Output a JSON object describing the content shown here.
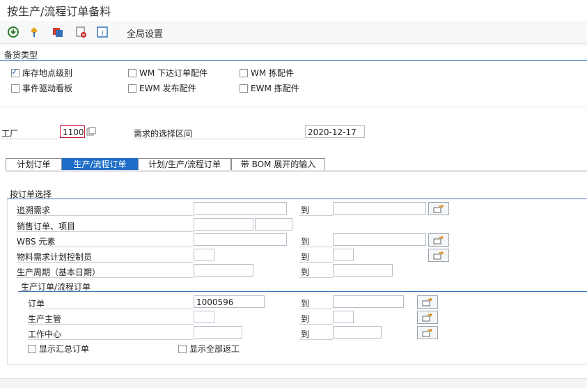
{
  "window": {
    "title": "按生产/流程订单备料"
  },
  "toolbar": {
    "global_settings": "全局设置"
  },
  "section1": {
    "title": "备货类型",
    "options": [
      {
        "label": "库存地点级别",
        "checked": true
      },
      {
        "label": "WM 下达订单配件",
        "checked": false
      },
      {
        "label": "WM 拣配件",
        "checked": false
      },
      {
        "label": "事件驱动看板",
        "checked": false
      },
      {
        "label": "EWM 发布配件",
        "checked": false
      },
      {
        "label": "EWM 拣配件",
        "checked": false
      }
    ]
  },
  "header": {
    "plant_label": "工厂",
    "plant_value": "1100",
    "req_label": "需求的选择区间",
    "req_value": "2020-12-17"
  },
  "tabs": [
    {
      "label": "计划订单",
      "active": false
    },
    {
      "label": "生产/流程订单",
      "active": true
    },
    {
      "label": "计划/生产/流程订单",
      "active": false
    },
    {
      "label": "带 BOM 展开的输入",
      "active": false
    }
  ],
  "order_select": {
    "title": "按订单选择",
    "to_label": "到",
    "rows": {
      "r1": "追溯需求",
      "r2": "销售订单、项目",
      "r3": "WBS 元素",
      "r4": "物料需求计划控制员",
      "r5": "生产周期（基本日期）"
    }
  },
  "prod_orders": {
    "title": "生产订单/流程订单",
    "order_label": "订单",
    "order_value": "1000596",
    "supervisor_label": "生产主管",
    "work_center_label": "工作中心",
    "show_collective": "显示汇总订单",
    "show_rework": "显示全部返工"
  }
}
